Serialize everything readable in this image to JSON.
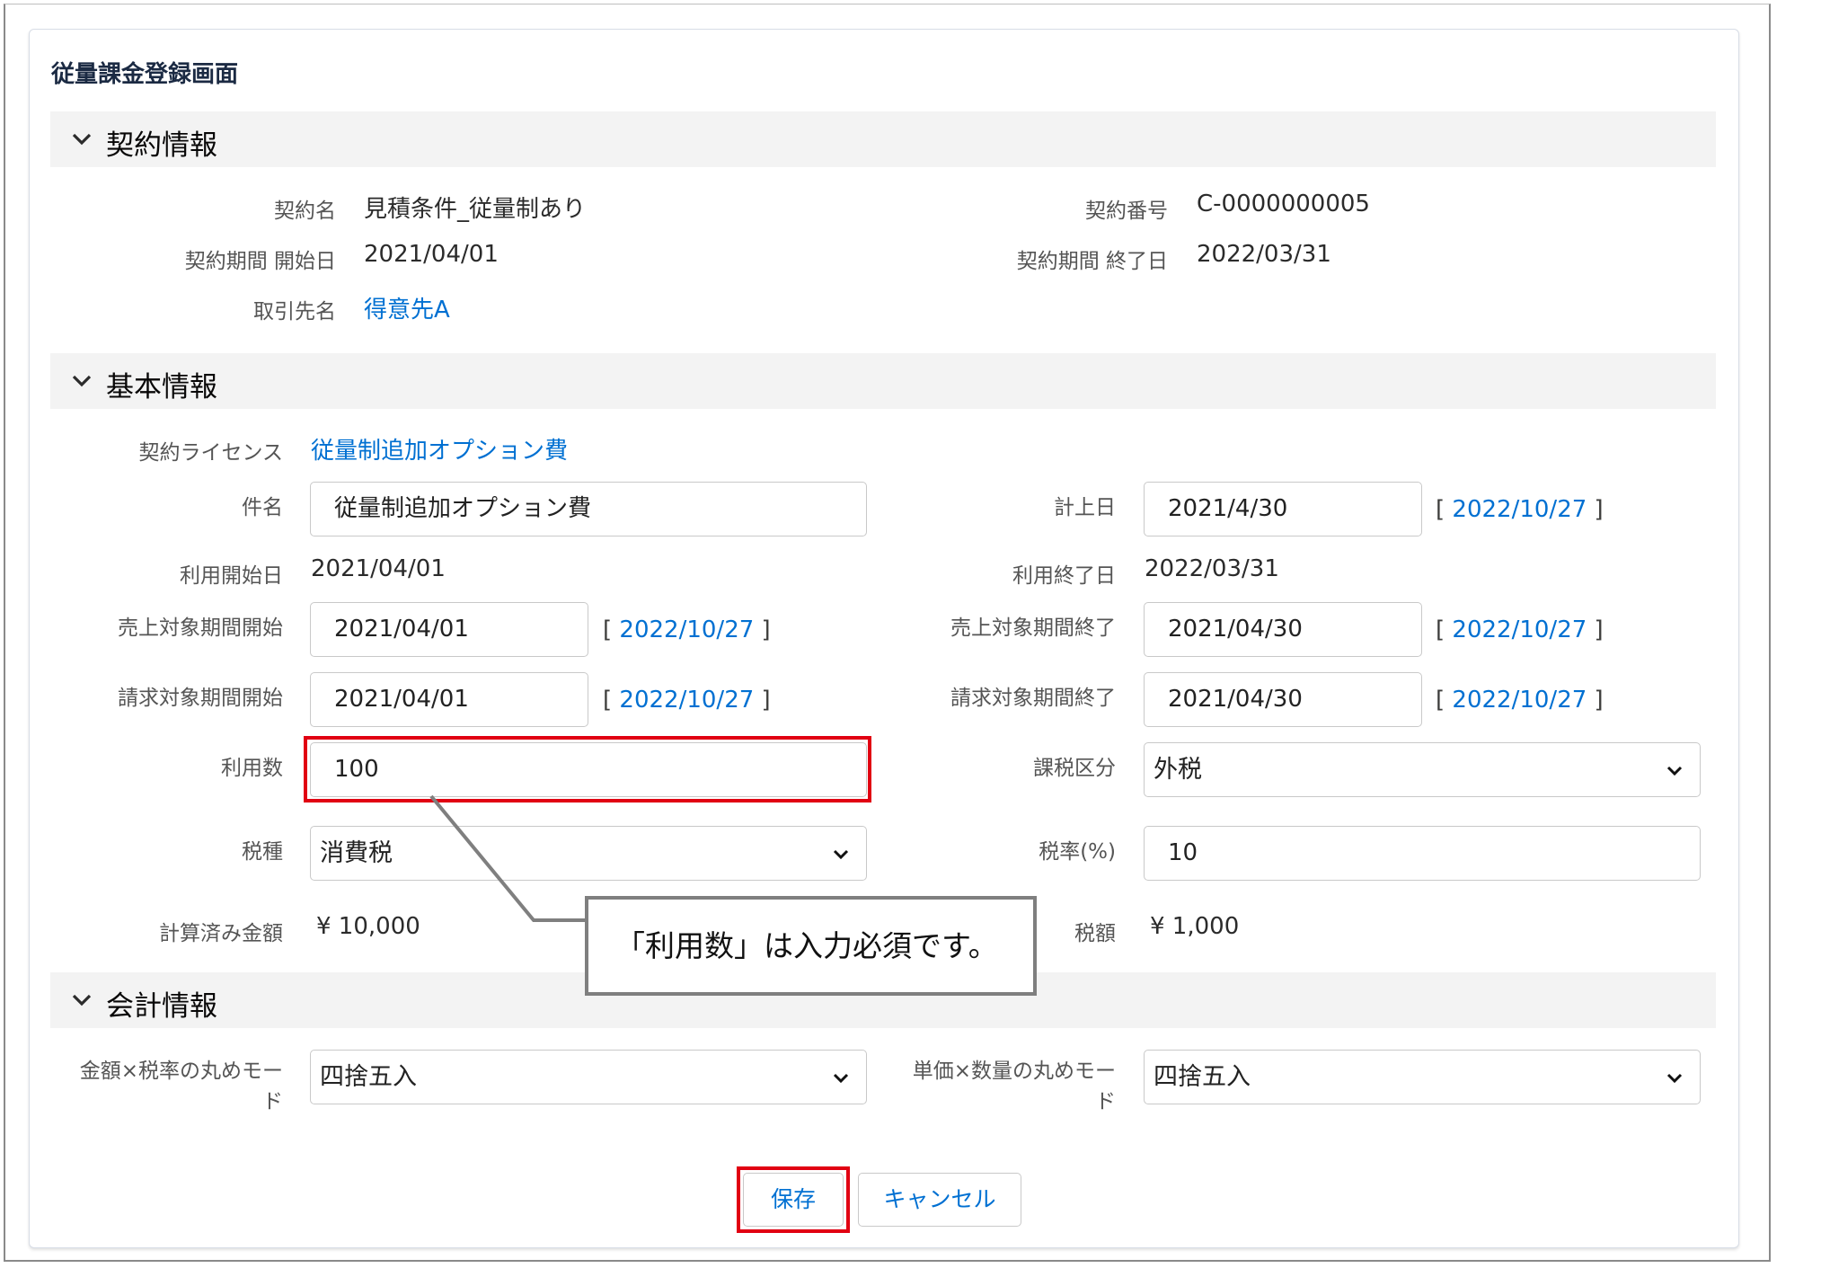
{
  "page_title": "従量課金登録画面",
  "sections": {
    "contract": {
      "label": "契約情報"
    },
    "basic": {
      "label": "基本情報"
    },
    "accounting": {
      "label": "会計情報"
    }
  },
  "contract": {
    "name_label": "契約名",
    "name_value": "見積条件_従量制あり",
    "number_label": "契約番号",
    "number_value": "C-0000000005",
    "start_label": "契約期間 開始日",
    "start_value": "2021/04/01",
    "end_label": "契約期間 終了日",
    "end_value": "2022/03/31",
    "client_label": "取引先名",
    "client_value": "得意先A"
  },
  "basic": {
    "license_label": "契約ライセンス",
    "license_value": "従量制追加オプション費",
    "subject_label": "件名",
    "subject_value": "従量制追加オプション費",
    "posting_label": "計上日",
    "posting_value": "2021/4/30",
    "posting_today": "2022/10/27",
    "use_start_label": "利用開始日",
    "use_start_value": "2021/04/01",
    "use_end_label": "利用終了日",
    "use_end_value": "2022/03/31",
    "sales_start_label": "売上対象期間開始",
    "sales_start_value": "2021/04/01",
    "sales_start_today": "2022/10/27",
    "sales_end_label": "売上対象期間終了",
    "sales_end_value": "2021/04/30",
    "sales_end_today": "2022/10/27",
    "bill_start_label": "請求対象期間開始",
    "bill_start_value": "2021/04/01",
    "bill_start_today": "2022/10/27",
    "bill_end_label": "請求対象期間終了",
    "bill_end_value": "2021/04/30",
    "bill_end_today": "2022/10/27",
    "usage_label": "利用数",
    "usage_value": "100",
    "tax_class_label": "課税区分",
    "tax_class_value": "外税",
    "tax_type_label": "税種",
    "tax_type_value": "消費税",
    "tax_rate_label": "税率(%)",
    "tax_rate_value": "10",
    "calc_amount_label": "計算済み金額",
    "calc_amount_value": "¥ 10,000",
    "tax_amount_label": "税額",
    "tax_amount_value": "¥ 1,000"
  },
  "accounting": {
    "rounding1_label_line1": "金額×税率の丸めモー",
    "rounding1_label_line2": "ド",
    "rounding1_value": "四捨五入",
    "rounding2_label_line1": "単価×数量の丸めモー",
    "rounding2_label_line2": "ド",
    "rounding2_value": "四捨五入"
  },
  "buttons": {
    "save": "保存",
    "cancel": "キャンセル"
  },
  "datelink_brackets": {
    "open": "[",
    "close": "]"
  },
  "callout": {
    "text": "「利用数」は入力必須です。"
  },
  "colors": {
    "link": "#0070d2",
    "highlight": "#e10012",
    "section_bg": "#f3f3f3"
  },
  "icons": {
    "section_toggle": "chevron-down-icon",
    "select_caret": "chevron-down-icon"
  }
}
